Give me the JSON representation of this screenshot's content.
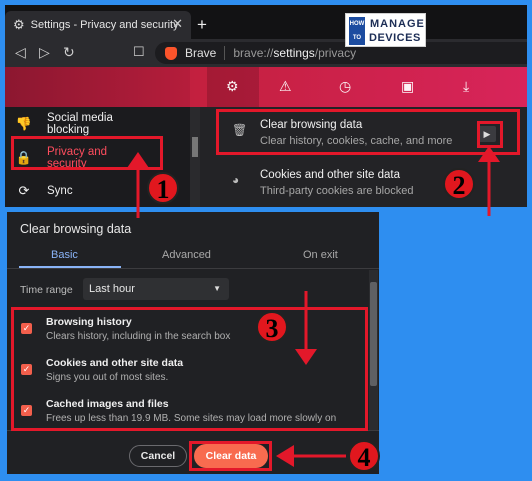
{
  "browser": {
    "tab_title": "Settings - Privacy and security",
    "new_tab": "+",
    "brave_label": "Brave",
    "url_scheme": "brave://",
    "url_host": "settings",
    "url_path": "/privacy"
  },
  "logo": {
    "how_to": "HOW TO",
    "line1": "MANAGE",
    "line2": "DEVICES"
  },
  "sidebar": {
    "items": [
      {
        "label_line1": "Social media",
        "label_line2": "blocking"
      },
      {
        "label_line1": "Privacy and",
        "label_line2": "security"
      },
      {
        "label_line1": "Sync",
        "label_line2": ""
      }
    ]
  },
  "settings_rows": [
    {
      "title": "Clear browsing data",
      "subtitle": "Clear history, cookies, cache, and more"
    },
    {
      "title": "Cookies and other site data",
      "subtitle": "Third-party cookies are blocked"
    }
  ],
  "dialog": {
    "title": "Clear browsing data",
    "tabs": [
      "Basic",
      "Advanced",
      "On exit"
    ],
    "time_range_label": "Time range",
    "time_range_value": "Last hour",
    "options": [
      {
        "title": "Browsing history",
        "subtitle": "Clears history, including in the search box",
        "checked": true
      },
      {
        "title": "Cookies and other site data",
        "subtitle": "Signs you out of most sites.",
        "checked": true
      },
      {
        "title": "Cached images and files",
        "subtitle": "Frees up less than 19.9 MB. Some sites may load more slowly on",
        "checked": true
      }
    ],
    "cancel_label": "Cancel",
    "clear_label": "Clear data"
  },
  "annotations": {
    "step1": "1",
    "step2": "2",
    "step3": "3",
    "step4": "4"
  },
  "colors": {
    "accent": "#e3182a",
    "brand": "#fb542b",
    "checkbox": "#f25f4c",
    "clear_button": "#f86b4f",
    "background": "#2e8ef0"
  }
}
